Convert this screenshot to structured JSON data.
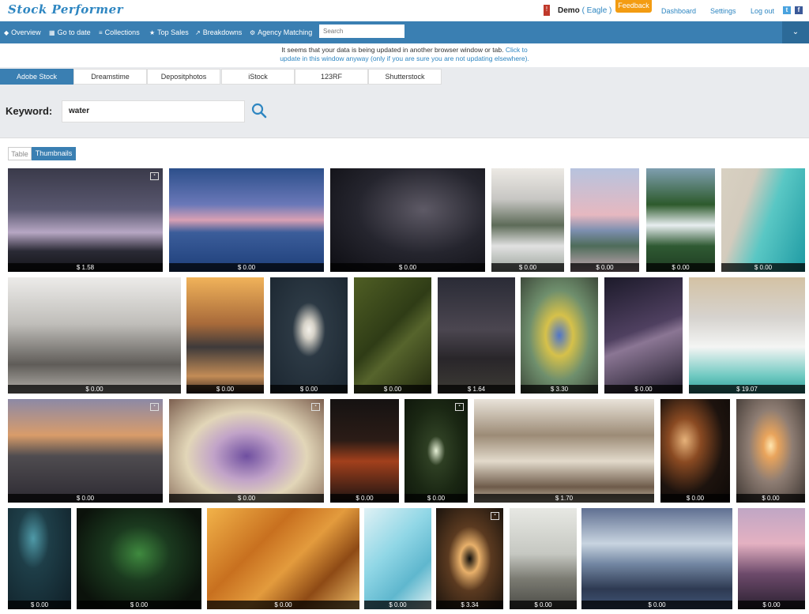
{
  "app": {
    "logo": "Stock Performer",
    "notification_count": "!",
    "user_label": "Demo",
    "user_plan": "( Eagle )",
    "feedback": "Feedback",
    "links": [
      "Dashboard",
      "Settings",
      "Log out"
    ],
    "social": [
      "t",
      "f"
    ]
  },
  "nav": {
    "items": [
      {
        "icon": "◆",
        "label": "Overview"
      },
      {
        "icon": "▦",
        "label": "Go to date"
      },
      {
        "icon": "≡",
        "label": "Collections"
      },
      {
        "icon": "★",
        "label": "Top Sales"
      },
      {
        "icon": "↗",
        "label": "Breakdowns"
      },
      {
        "icon": "⚙",
        "label": "Agency Matching"
      }
    ],
    "search_placeholder": "Search",
    "toggle": "⌄"
  },
  "notice": {
    "line1": "It seems that your data is being updated in another browser window or tab.",
    "link1": "Click to",
    "link2": "update in this window anyway (only if you are sure you are not updating elsewhere)."
  },
  "agency_tabs": [
    "Adobe Stock",
    "Dreamstime",
    "Depositphotos",
    "iStock",
    "123RF",
    "Shutterstock"
  ],
  "active_tab": "Adobe Stock",
  "keyword": {
    "label": "Keyword:",
    "value": "water"
  },
  "view": {
    "table": "Table",
    "thumbnails": "Thumbnails"
  },
  "thumbnails": [
    {
      "price": "$ 1.58",
      "bg": "linear-gradient(180deg,#3a3a4a 0%,#5a5870 40%,#b7a7c4 62%,#2a2a35 80%,#141418 100%)",
      "badge": "▪"
    },
    {
      "price": "$ 0.00",
      "bg": "linear-gradient(180deg,#2c4f8a 0%,#6a78b8 35%,#d9a0b4 50%,#3b5d9a 62%,#1e3f7a 100%)"
    },
    {
      "price": "$ 0.00",
      "bg": "radial-gradient(ellipse at 60% 40%,#5e5a66 0%,#25252e 50%,#0d0d12 100%)"
    },
    {
      "price": "$ 0.00",
      "bg": "linear-gradient(180deg,#ece9e4 0%,#c7c6c3 30%,#5d6b58 55%,#e1e1e1 75%,#9aa39a 100%)"
    },
    {
      "price": "$ 0.00",
      "bg": "linear-gradient(180deg,#b7c3de 0%,#e6b8c0 45%,#7d8fb0 60%,#4e6c5a 75%,#c7a9b5 100%)"
    },
    {
      "price": "$ 0.00",
      "bg": "linear-gradient(180deg,#7f9fb0 0%,#2d5a2c 35%,#e8eef0 55%,#2f5a33 75%,#1f3c22 100%)"
    },
    {
      "price": "$ 0.00",
      "bg": "linear-gradient(110deg,#d8d1c2 0%,#d3cbbd 30%,#59c7c4 55%,#1e9aa3 100%)"
    },
    {
      "price": "$ 0.00",
      "bg": "linear-gradient(180deg,#ecebe9 0%,#c0beba 40%,#5f5c58 75%,#b5b2ac 100%)"
    },
    {
      "price": "$ 0.00",
      "bg": "linear-gradient(180deg,#f1b35a 0%,#a86a3a 40%,#3e3a3a 60%,#c38c56 85%,#3b2b22 100%)"
    },
    {
      "price": "$ 0.00",
      "bg": "radial-gradient(ellipse at 50% 45%,#f4f1ea 0%,#d6d2c8 10%,#2c3944 30%,#1b2630 100%)"
    },
    {
      "price": "$ 0.00",
      "bg": "linear-gradient(135deg,#4f5e24 0%,#2f3c16 45%,#56642c 60%,#22290f 100%)"
    },
    {
      "price": "$ 1.64",
      "bg": "linear-gradient(180deg,#2a2b36 0%,#4b4650 45%,#29262a 70%,#3d3b35 100%)"
    },
    {
      "price": "$ 3.30",
      "bg": "radial-gradient(ellipse at 50% 50%,#4f75c9 0%,#d6c14a 25%,#6f8f6d 55%,#3e4a3b 100%)"
    },
    {
      "price": "$ 0.00",
      "bg": "linear-gradient(160deg,#1c1a2a 0%,#4f4060 45%,#8b7694 55%,#1d1a28 100%)"
    },
    {
      "price": "$ 19.07",
      "bg": "linear-gradient(180deg,#d4c2a4 0%,#d6d3cf 35%,#f4f5f4 60%,#6fc9c1 85%,#2e9c9a 100%)"
    },
    {
      "price": "$ 0.00",
      "bg": "linear-gradient(180deg,#8c89a6 0%,#d99c6a 35%,#4f4c50 55%,#2d2a32 100%)",
      "badge": "▪"
    },
    {
      "price": "$ 0.00",
      "bg": "radial-gradient(ellipse at 50% 55%,#6f4fa0 0%,#c1a3c8 30%,#e2d6b8 55%,#7c5f4f 100%)",
      "badge": "▪"
    },
    {
      "price": "$ 0.00",
      "bg": "linear-gradient(180deg,#151212 0%,#2b1c16 40%,#a2401c 60%,#1a1312 100%)"
    },
    {
      "price": "$ 0.00",
      "bg": "radial-gradient(ellipse at 50% 50%,#e6f0d6 0%,#2e3f23 20%,#1a2713 60%,#0f170c 100%)",
      "badge": "▪"
    },
    {
      "price": "$ 1.70",
      "bg": "linear-gradient(180deg,#e9e3d9 0%,#9c8b76 35%,#e2dacb 60%,#6e5b4a 85%,#c8bda9 100%)"
    },
    {
      "price": "$ 0.00",
      "bg": "radial-gradient(ellipse at 35% 40%,#e6b27a 0%,#8a4a22 25%,#1d130e 60%,#0d0907 100%)"
    },
    {
      "price": "$ 0.00",
      "bg": "radial-gradient(ellipse at 50% 45%,#ffe6b0 0%,#e9a45c 15%,#8e7d73 45%,#3c3531 100%)"
    },
    {
      "price": "$ 0.00",
      "bg": "radial-gradient(ellipse at 40% 30%,#4f9aa8 0%,#1e3e48 30%,#0f1e26 100%)"
    },
    {
      "price": "$ 0.00",
      "bg": "radial-gradient(ellipse at 50% 45%,#3f8a3f 0%,#1b3a1f 35%,#0b120b 80%)"
    },
    {
      "price": "$ 0.00",
      "bg": "linear-gradient(135deg,#f2b34a 0%,#c8701f 35%,#e39b3d 55%,#8e4a15 75%,#f0c06a 100%)"
    },
    {
      "price": "$ 0.00",
      "bg": "linear-gradient(135deg,#dff1f5 0%,#91d7e6 40%,#5fb7ce 70%,#e5f3f3 100%)"
    },
    {
      "price": "$ 3.34",
      "bg": "radial-gradient(ellipse at 50% 50%,#0c0b09 0%,#e8b06a 20%,#5b3a20 45%,#1a130d 100%)",
      "badge": "▪"
    },
    {
      "price": "$ 0.00",
      "bg": "linear-gradient(180deg,#e7e8e3 0%,#c6c8c2 45%,#7b7b72 70%,#4a4a45 100%)"
    },
    {
      "price": "$ 0.00",
      "bg": "linear-gradient(180deg,#5f6f91 0%,#c8d4e0 35%,#7387a3 55%,#2e3a52 80%,#415578 100%)"
    },
    {
      "price": "$ 0.00",
      "bg": "linear-gradient(180deg,#c0a6c4 0%,#e4b1c2 35%,#6d4a6b 65%,#2a2030 100%)"
    }
  ],
  "colors": {
    "accent": "#3a7fb2",
    "feedback": "#f39c12",
    "link": "#2e86c1"
  }
}
